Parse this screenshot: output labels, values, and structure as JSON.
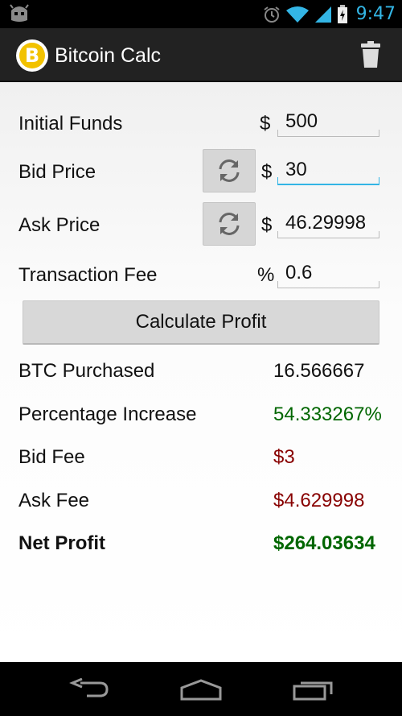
{
  "status_bar": {
    "time": "9:47"
  },
  "app": {
    "title": "Bitcoin Calc",
    "logo_letter": "B"
  },
  "inputs": [
    {
      "label": "Initial Funds",
      "unit": "$",
      "value": "500"
    },
    {
      "label": "Bid Price",
      "unit": "$",
      "value": "30"
    },
    {
      "label": "Ask Price",
      "unit": "$",
      "value": "46.29998"
    },
    {
      "label": "Transaction Fee",
      "unit": "%",
      "value": "0.6"
    }
  ],
  "calculate_button": {
    "label": "Calculate Profit"
  },
  "results": [
    {
      "label": "BTC Purchased",
      "value": "16.566667",
      "color": "#111111"
    },
    {
      "label": "Percentage Increase",
      "value": "54.333267%",
      "color": "#006600"
    },
    {
      "label": "Bid Fee",
      "value": "$3",
      "color": "#880000"
    },
    {
      "label": "Ask Fee",
      "value": "$4.629998",
      "color": "#880000"
    },
    {
      "label": "Net Profit",
      "value": "$264.03634",
      "color": "#006600"
    }
  ],
  "colors": {
    "accent": "#33b5e5",
    "profit": "#006600",
    "fee": "#880000"
  },
  "icons": [
    "android-icon",
    "alarm-icon",
    "wifi-icon",
    "signal-icon",
    "battery-icon",
    "trash-icon",
    "swap-icon",
    "back-icon",
    "home-icon",
    "recents-icon"
  ]
}
